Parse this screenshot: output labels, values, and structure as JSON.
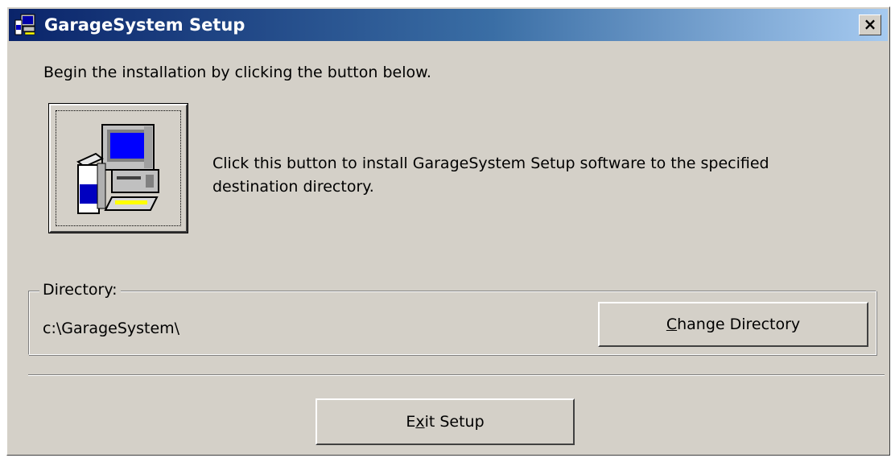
{
  "window": {
    "title": "GarageSystem Setup",
    "close_label": "×"
  },
  "intro": "Begin the installation by clicking the button below.",
  "install": {
    "description": "Click this button to install GarageSystem Setup software to the specified destination directory."
  },
  "directory": {
    "group_label": "Directory:",
    "value": "c:\\GarageSystem\\",
    "change_button": {
      "prefix": "",
      "accel": "C",
      "suffix": "hange Directory"
    }
  },
  "exit_button": {
    "prefix": "E",
    "accel": "x",
    "suffix": "it Setup"
  },
  "icons": {
    "title": "setup-computer-icon",
    "install": "setup-computer-icon",
    "close": "close-icon"
  },
  "colors": {
    "titlebar_start": "#0a246a",
    "titlebar_end": "#a6caf0",
    "face": "#d4d0c8"
  }
}
